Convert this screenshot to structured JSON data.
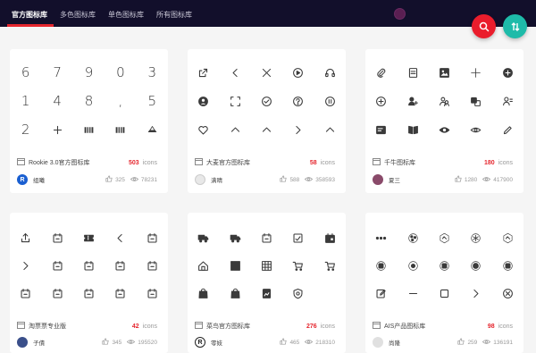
{
  "nav": {
    "tabs": [
      "官方图标库",
      "多色图标库",
      "单色图标库",
      "所有图标库"
    ],
    "active_index": 0
  },
  "colors": {
    "topbar": "#120f2b",
    "accent_red": "#e5262e",
    "search_fab": "#ea1d2c",
    "sort_fab": "#1ebba9"
  },
  "fabs": {
    "search_icon": "search-icon",
    "sort_icon": "sort-icon"
  },
  "cards": [
    {
      "name": "Rookie 3.0官方图标库",
      "count": "503",
      "unit": "icons",
      "author": "组曦",
      "likes": "325",
      "views": "78231",
      "icons": [
        "6",
        "7",
        "9",
        "0",
        "3",
        "1",
        "4",
        "8",
        ",",
        "5",
        "2",
        "plus",
        "table",
        "table",
        "ship"
      ]
    },
    {
      "name": "大麦官方图标库",
      "count": "58",
      "unit": "icons",
      "author": "满晴",
      "likes": "588",
      "views": "358593",
      "icons": [
        "share",
        "chevron-left",
        "close",
        "play-circle",
        "headset",
        "user-circle",
        "scan",
        "check-circle",
        "help-circle",
        "pause-circle",
        "heart",
        "chevron-up",
        "chevron-up",
        "chevron-right",
        "chevron-up"
      ]
    },
    {
      "name": "千牛图标库",
      "count": "180",
      "unit": "icons",
      "author": "夏三",
      "likes": "1280",
      "views": "417900",
      "icons": [
        "clip",
        "doc",
        "image",
        "plus-thin",
        "plus-circle",
        "plus-circle-outline",
        "user-add",
        "users",
        "user-group",
        "user-doc",
        "doc-text",
        "book",
        "eye",
        "eye-outline",
        "edit"
      ]
    },
    {
      "name": "淘票票专业版",
      "count": "42",
      "unit": "icons",
      "author": "子債",
      "likes": "345",
      "views": "195520",
      "icons": [
        "upload",
        "calendar",
        "ticket",
        "chevron-left",
        "calendar",
        "chevron-right",
        "calendar",
        "calendar",
        "calendar",
        "calendar",
        "calendar",
        "calendar",
        "calendar",
        "calendar",
        "calendar"
      ]
    },
    {
      "name": "菜鸟官方图标库",
      "count": "276",
      "unit": "icons",
      "author": "零妓",
      "likes": "465",
      "views": "218310",
      "icons": [
        "truck",
        "truck",
        "calendar",
        "box-check",
        "box",
        "house",
        "grid",
        "grid-lines",
        "cart",
        "cart",
        "bag",
        "bag",
        "doc-image",
        "shield"
      ]
    },
    {
      "name": "AIS产品图标库",
      "count": "98",
      "unit": "icons",
      "author": "尚隆",
      "likes": "259",
      "views": "136191",
      "icons": [
        "dots",
        "nodes",
        "hexagon",
        "asterisk",
        "hexagon",
        "badge",
        "sun",
        "badge",
        "circle-dot",
        "badge",
        "edit-box",
        "minus",
        "square",
        "chevron-right",
        "close-circle"
      ]
    }
  ]
}
